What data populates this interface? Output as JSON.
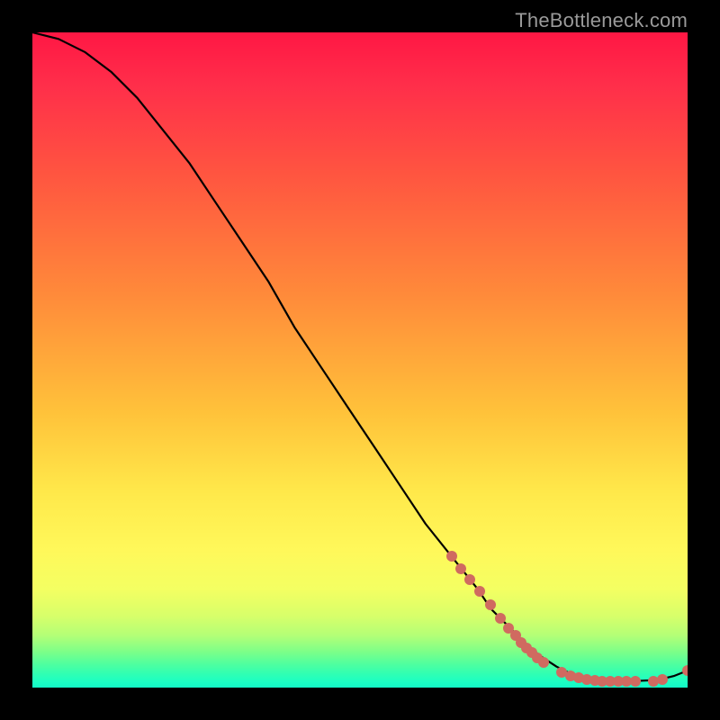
{
  "watermark": "TheBottleneck.com",
  "chart_data": {
    "type": "line",
    "title": "",
    "xlabel": "",
    "ylabel": "",
    "xlim": [
      0,
      100
    ],
    "ylim": [
      0,
      100
    ],
    "grid": false,
    "legend": false,
    "series": [
      {
        "name": "bottleneck-curve",
        "x": [
          0,
          4,
          8,
          12,
          16,
          20,
          24,
          28,
          32,
          36,
          40,
          44,
          48,
          52,
          56,
          60,
          64,
          68,
          70,
          72,
          74,
          76,
          78,
          80,
          82,
          84,
          86,
          88,
          90,
          92,
          94,
          96,
          98,
          100
        ],
        "y": [
          100,
          99,
          97,
          94,
          90,
          85,
          80,
          74,
          68,
          62,
          55,
          49,
          43,
          37,
          31,
          25,
          20,
          15,
          12,
          10,
          8,
          6,
          4.5,
          3.2,
          2.2,
          1.6,
          1.2,
          1.0,
          1.0,
          1.0,
          1.1,
          1.3,
          1.8,
          2.6
        ]
      }
    ],
    "markers": [
      {
        "x": 64.0,
        "y": 20.0
      },
      {
        "x": 65.4,
        "y": 18.2
      },
      {
        "x": 66.8,
        "y": 16.5
      },
      {
        "x": 68.3,
        "y": 14.7
      },
      {
        "x": 69.9,
        "y": 12.6
      },
      {
        "x": 71.4,
        "y": 10.6
      },
      {
        "x": 72.7,
        "y": 9.0
      },
      {
        "x": 73.7,
        "y": 7.9
      },
      {
        "x": 74.6,
        "y": 6.9
      },
      {
        "x": 75.4,
        "y": 6.1
      },
      {
        "x": 76.2,
        "y": 5.3
      },
      {
        "x": 77.0,
        "y": 4.6
      },
      {
        "x": 78.0,
        "y": 3.8
      },
      {
        "x": 80.8,
        "y": 2.3
      },
      {
        "x": 82.2,
        "y": 1.8
      },
      {
        "x": 83.4,
        "y": 1.5
      },
      {
        "x": 84.6,
        "y": 1.3
      },
      {
        "x": 85.8,
        "y": 1.1
      },
      {
        "x": 87.0,
        "y": 1.0
      },
      {
        "x": 88.2,
        "y": 1.0
      },
      {
        "x": 89.4,
        "y": 0.9
      },
      {
        "x": 90.6,
        "y": 0.9
      },
      {
        "x": 92.0,
        "y": 0.9
      },
      {
        "x": 94.8,
        "y": 1.0
      },
      {
        "x": 96.2,
        "y": 1.2
      },
      {
        "x": 100.0,
        "y": 2.6
      }
    ],
    "gradient_colors": {
      "top": "#ff1744",
      "mid": "#ffe84a",
      "bottom": "#14f7c6"
    }
  }
}
